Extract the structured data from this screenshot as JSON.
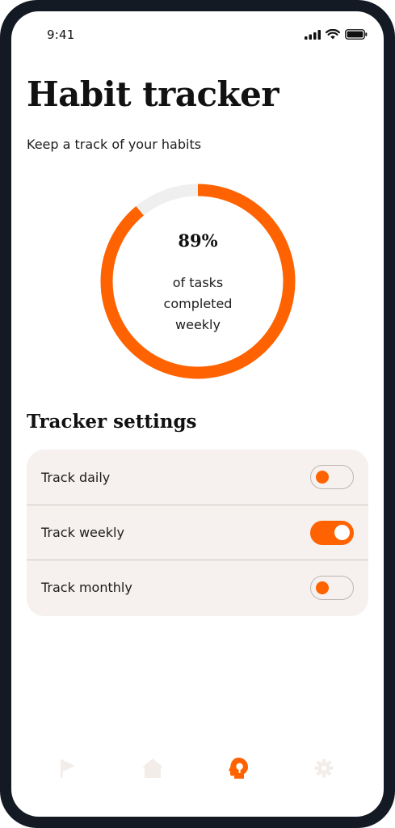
{
  "status_bar": {
    "time": "9:41"
  },
  "header": {
    "title": "Habit tracker",
    "subtitle": "Keep a track of your habits"
  },
  "progress": {
    "percent_label": "89%",
    "value": 0.89,
    "caption": "of tasks completed weekly"
  },
  "settings": {
    "title": "Tracker settings",
    "items": [
      {
        "label": "Track daily",
        "enabled": false
      },
      {
        "label": "Track weekly",
        "enabled": true
      },
      {
        "label": "Track monthly",
        "enabled": false
      }
    ]
  },
  "bottom_nav": {
    "items": [
      {
        "icon": "flag-icon",
        "active": false
      },
      {
        "icon": "home-icon",
        "active": false
      },
      {
        "icon": "head-icon",
        "active": true
      },
      {
        "icon": "gear-icon",
        "active": false
      }
    ]
  },
  "colors": {
    "accent": "#ff6200",
    "track": "#efefef",
    "card": "#f6f1ee",
    "nav_inactive": "#f3ede9",
    "frame": "#141a24"
  }
}
